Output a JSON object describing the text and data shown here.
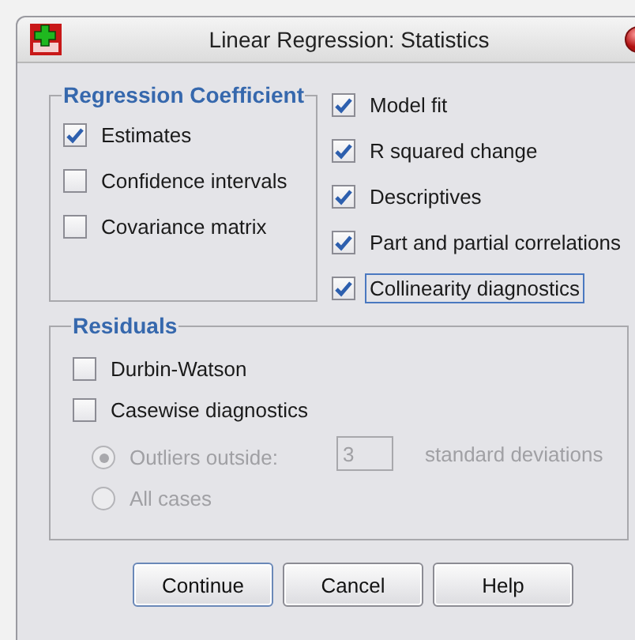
{
  "window": {
    "title": "Linear Regression: Statistics"
  },
  "regression_coefficient": {
    "title": "Regression Coefficient",
    "options": [
      {
        "label": "Estimates",
        "checked": true
      },
      {
        "label": "Confidence intervals",
        "checked": false
      },
      {
        "label": "Covariance matrix",
        "checked": false
      }
    ]
  },
  "statistics": [
    {
      "label": "Model fit",
      "checked": true,
      "focused": false
    },
    {
      "label": "R squared change",
      "checked": true,
      "focused": false
    },
    {
      "label": "Descriptives",
      "checked": true,
      "focused": false
    },
    {
      "label": "Part and partial correlations",
      "checked": true,
      "focused": false
    },
    {
      "label": "Collinearity diagnostics",
      "checked": true,
      "focused": true
    }
  ],
  "residuals": {
    "title": "Residuals",
    "options": [
      {
        "label": "Durbin-Watson",
        "checked": false
      },
      {
        "label": "Casewise diagnostics",
        "checked": false
      }
    ],
    "casewise": {
      "disabled": true,
      "choices": [
        {
          "label": "Outliers outside:",
          "selected": true
        },
        {
          "label": "All cases",
          "selected": false
        }
      ],
      "field": {
        "value": "3"
      },
      "unit": "standard deviations"
    }
  },
  "buttons": [
    {
      "label": "Continue",
      "default": true
    },
    {
      "label": "Cancel",
      "default": false
    },
    {
      "label": "Help",
      "default": false
    }
  ]
}
